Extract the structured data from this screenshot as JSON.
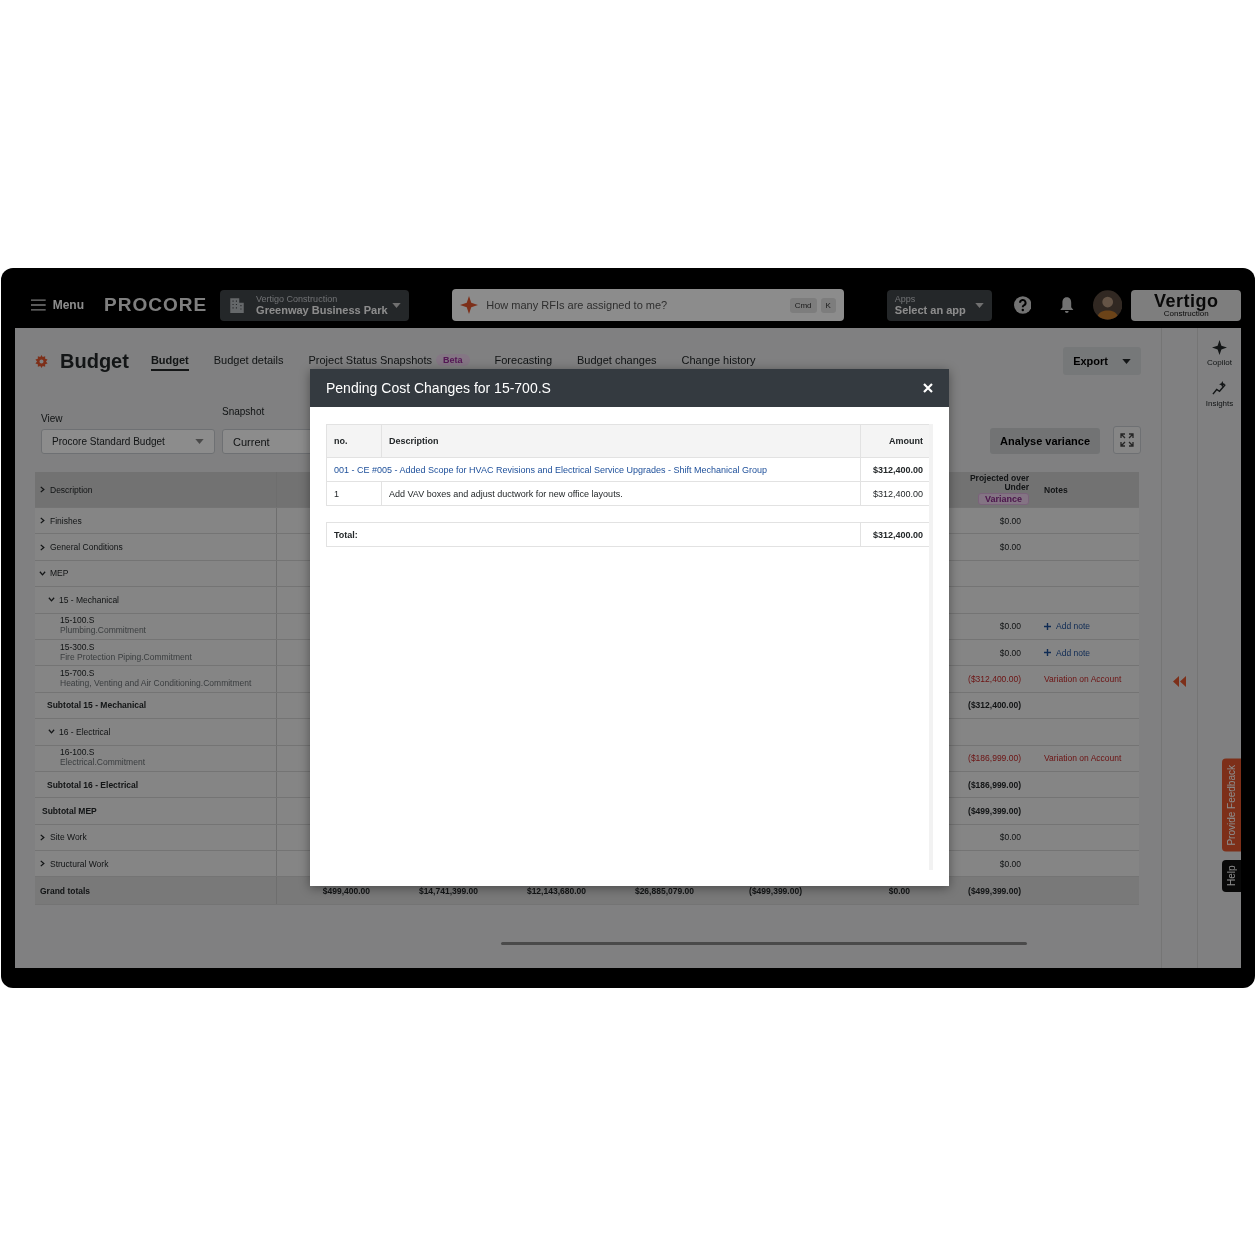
{
  "nav": {
    "menu_label": "Menu",
    "logo": "PROCORE",
    "project": {
      "company": "Vertigo Construction",
      "name": "Greenway Business Park"
    },
    "search": {
      "placeholder": "How many RFIs are assigned to me?",
      "keys": [
        "Cmd",
        "K"
      ]
    },
    "apps": {
      "label": "Apps",
      "value": "Select an app"
    },
    "brand": {
      "name": "Vertigo",
      "tagline": "Construction"
    }
  },
  "page": {
    "title": "Budget",
    "tabs": [
      {
        "label": "Budget",
        "selected": true
      },
      {
        "label": "Budget details",
        "selected": false
      },
      {
        "label": "Project Status Snapshots",
        "badge": "Beta",
        "selected": false
      },
      {
        "label": "Forecasting",
        "selected": false
      },
      {
        "label": "Budget changes",
        "selected": false
      },
      {
        "label": "Change history",
        "selected": false
      }
    ],
    "export_button": "Export",
    "view": {
      "label": "View",
      "value": "Procore Standard Budget"
    },
    "snapshot": {
      "label": "Snapshot",
      "value": "Current"
    },
    "analyse_button": "Analyse variance"
  },
  "table": {
    "description_header": "Description",
    "variance_header": {
      "title": "Projected over Under",
      "badge": "Variance"
    },
    "notes_header": "Notes",
    "rows": [
      {
        "kind": "group",
        "label": "Finishes",
        "expanded": false,
        "variance": "$0.00",
        "flagged": false
      },
      {
        "kind": "group",
        "label": "General Conditions",
        "expanded": false,
        "variance": "$0.00",
        "flagged": false
      },
      {
        "kind": "group",
        "label": "MEP",
        "expanded": true,
        "children": [
          {
            "kind": "group",
            "label": "15 - Mechanical",
            "expanded": true,
            "children": [
              {
                "kind": "code",
                "code": "15-100.S",
                "detail": "Plumbing.Commitment",
                "variance": "$0.00",
                "flagged": false,
                "note": {
                  "kind": "add",
                  "text": "Add note"
                }
              },
              {
                "kind": "code",
                "code": "15-300.S",
                "detail": "Fire Protection Piping.Commitment",
                "variance": "$0.00",
                "flagged": false,
                "note": {
                  "kind": "add",
                  "text": "Add note"
                }
              },
              {
                "kind": "code",
                "code": "15-700.S",
                "detail": "Heating, Venting and Air Conditioning.Commitment",
                "variance": "($312,400.00)",
                "flagged": true,
                "note": {
                  "kind": "variation",
                  "text": "Variation on Account"
                }
              }
            ]
          },
          {
            "kind": "subtotal",
            "label": "Subtotal 15 - Mechanical",
            "variance": "($312,400.00)"
          },
          {
            "kind": "group",
            "label": "16 - Electrical",
            "expanded": true,
            "children": [
              {
                "kind": "code",
                "code": "16-100.S",
                "detail": "Electrical.Commitment",
                "variance": "($186,999.00)",
                "flagged": true,
                "note": {
                  "kind": "variation",
                  "text": "Variation on Account"
                }
              }
            ]
          },
          {
            "kind": "subtotal",
            "label": "Subtotal 16 - Electrical",
            "variance": "($186,999.00)"
          }
        ]
      },
      {
        "kind": "subtotal",
        "label": "Subtotal MEP",
        "variance": "($499,399.00)"
      },
      {
        "kind": "group",
        "label": "Site Work",
        "expanded": false,
        "variance": "$0.00",
        "flagged": false
      },
      {
        "kind": "group",
        "label": "Structural Work",
        "expanded": false,
        "variance": "$0.00",
        "flagged": false
      }
    ],
    "grand_totals": {
      "label": "Grand totals",
      "values": [
        "$499,400.00",
        "$14,741,399.00",
        "$12,143,680.00",
        "$26,885,079.00",
        "($499,399.00)",
        "$0.00",
        "($499,399.00)"
      ]
    }
  },
  "rail": {
    "items": [
      {
        "kind": "copilot",
        "label": "Copilot"
      },
      {
        "kind": "insights",
        "label": "Insights"
      }
    ]
  },
  "feedback_tab": "Provide Feedback",
  "help_tab": "Help",
  "modal": {
    "title": "Pending Cost Changes for 15-700.S",
    "columns": [
      "no.",
      "Description",
      "Amount"
    ],
    "rows": [
      {
        "kind": "link",
        "text": "001 - CE #005 - Added Scope for HVAC Revisions and Electrical Service Upgrades - Shift Mechanical Group",
        "amount": "$312,400.00"
      },
      {
        "kind": "item",
        "no": "1",
        "text": "Add VAV boxes and adjust ductwork for new office layouts.",
        "amount": "$312,400.00"
      }
    ],
    "total": {
      "label": "Total:",
      "amount": "$312,400.00"
    }
  }
}
